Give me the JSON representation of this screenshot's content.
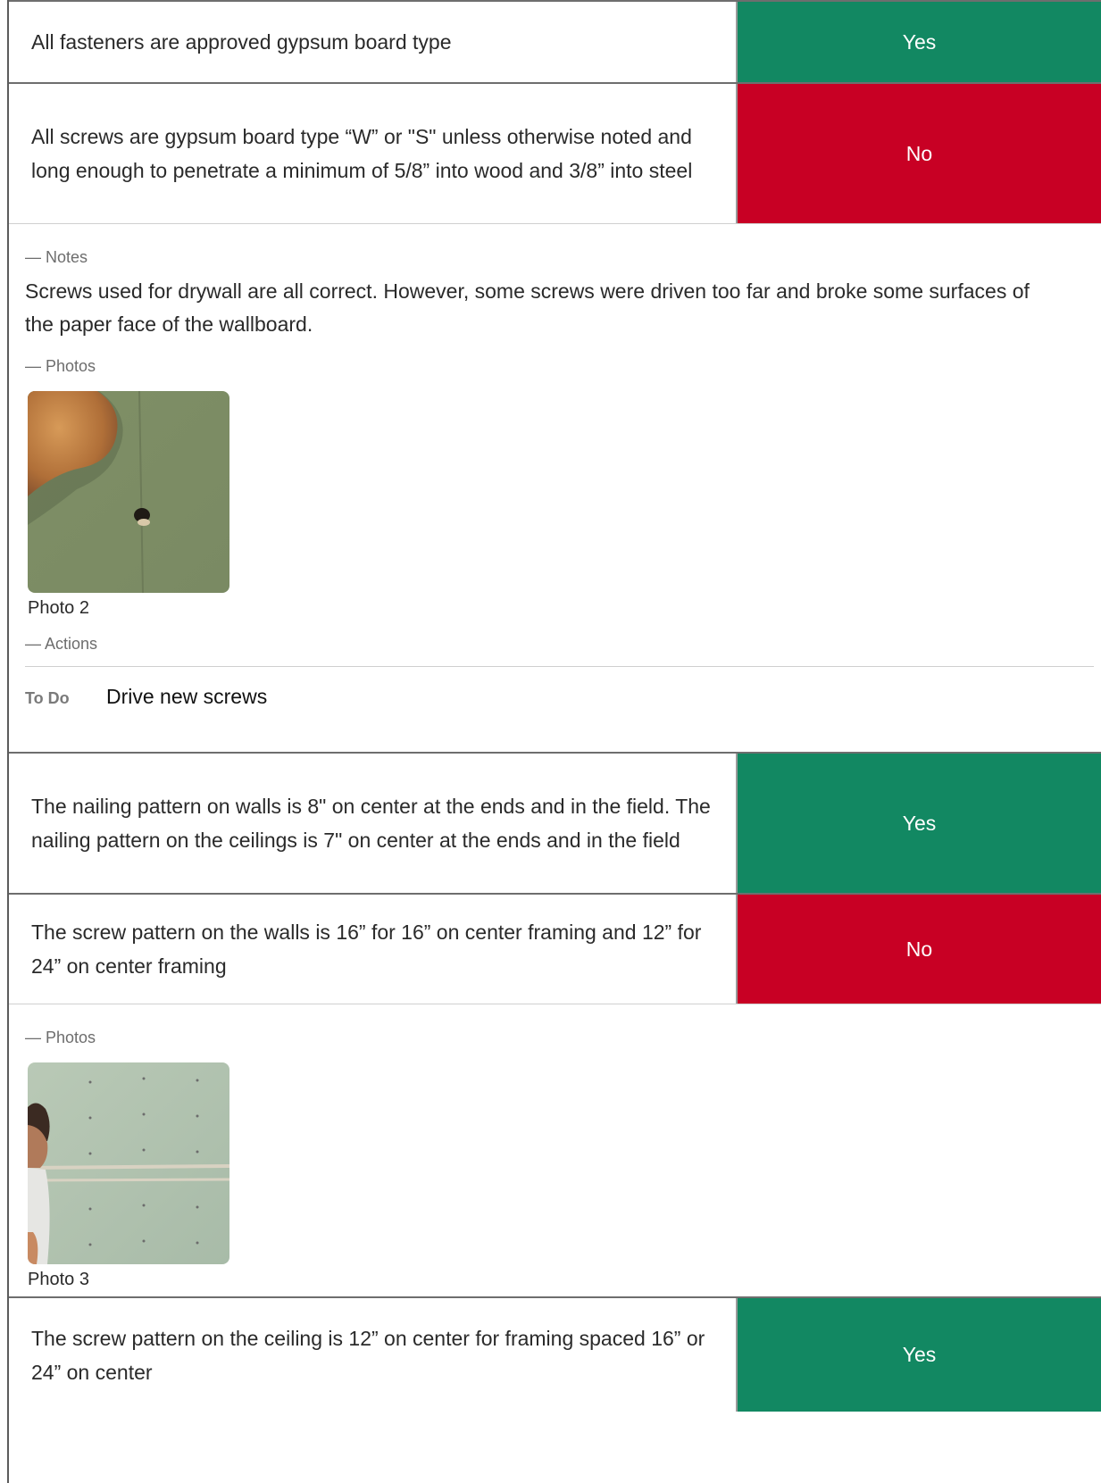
{
  "items": [
    {
      "question": "All fasteners are approved gypsum board type",
      "answer": "Yes"
    },
    {
      "question": "All screws are gypsum board type “W” or \"S\" unless otherwise noted and long enough to penetrate a minimum of 5/8” into wood and 3/8” into steel",
      "answer": "No",
      "notes_label": "— Notes",
      "notes": "Screws used for drywall are all correct. However, some screws were driven too far and broke some surfaces of the paper face of the wallboard.",
      "photos_label": "— Photos",
      "photo_caption": "Photo 2",
      "actions_label": "— Actions",
      "action_status": "To Do",
      "action_title": "Drive new screws"
    },
    {
      "question": "The nailing pattern on walls is 8\" on center at the ends and in the field. The nailing pattern on the ceilings is 7\" on center at the ends and in the field",
      "answer": "Yes"
    },
    {
      "question": "The screw pattern on the walls is 16” for 16” on center framing and 12” for 24” on center framing",
      "answer": "No",
      "photos_label": "— Photos",
      "photo_caption": "Photo 3"
    },
    {
      "question": "The screw pattern on the ceiling is 12” on center for framing spaced 16” or 24” on center",
      "answer": "Yes"
    }
  ],
  "colors": {
    "yes": "#128862",
    "no": "#c80024"
  },
  "icons": {
    "photo_2": "drywall-screw-hole-photo",
    "photo_3": "drywall-wall-screw-pattern-photo"
  }
}
